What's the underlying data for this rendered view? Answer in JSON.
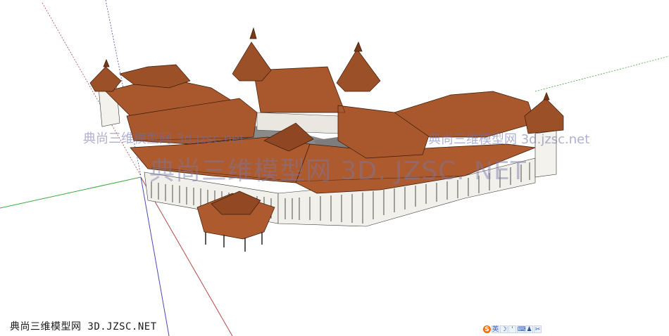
{
  "watermarks": {
    "left": "典尚三维模型网 3d.jzsc.net",
    "right": "典尚三维模型网 3d.jzsc.net",
    "center": "典尚三维模型网 3D. JZSC. NET",
    "bottom": "典尚三维模型网 3D.JZSC.NET"
  },
  "ime_toolbar": {
    "items": [
      {
        "icon": "sogou-logo-icon",
        "glyph": "S"
      },
      {
        "icon": "chinese-mode-icon",
        "glyph": "英"
      },
      {
        "icon": "moon-punctuation-icon",
        "glyph": "☽"
      },
      {
        "icon": "comma-icon",
        "glyph": "'"
      },
      {
        "icon": "keyboard-icon",
        "glyph": "⌨"
      },
      {
        "icon": "skin-icon",
        "glyph": "♟"
      },
      {
        "icon": "tools-icon",
        "glyph": "✂"
      }
    ]
  },
  "colors": {
    "roof": "#a8582c",
    "roof_dark": "#7a3a18",
    "wall": "#f2f0ea",
    "axis_red": "#b24a4a",
    "axis_green": "#3fa83f",
    "axis_blue": "#4a4ab2"
  }
}
